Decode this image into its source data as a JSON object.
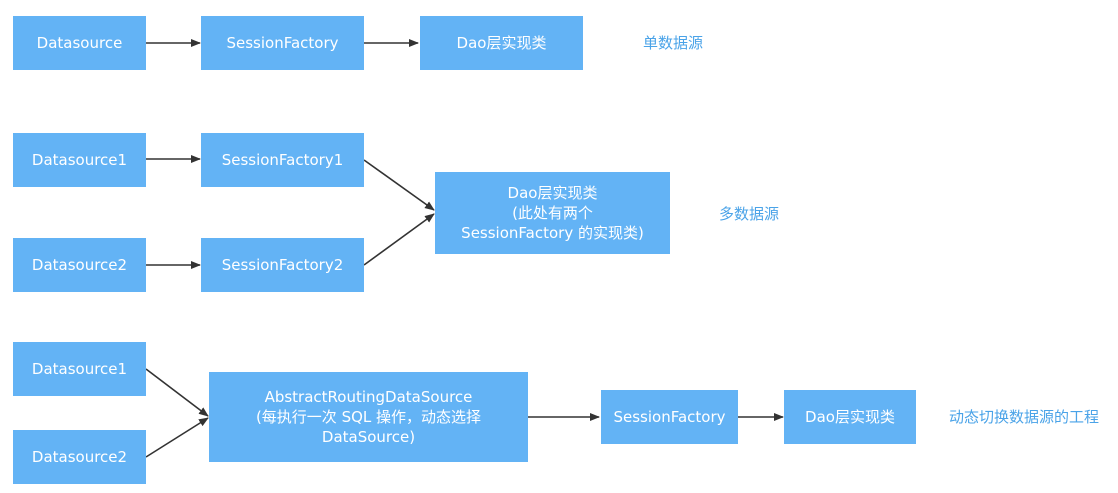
{
  "colors": {
    "node_fill": "#63b3f5",
    "node_text": "#ffffff",
    "caption": "#4aa3e8",
    "edge": "#333333"
  },
  "row1": {
    "datasource": "Datasource",
    "session_factory": "SessionFactory",
    "dao": "Dao层实现类",
    "caption": "单数据源"
  },
  "row2": {
    "datasource1": "Datasource1",
    "datasource2": "Datasource2",
    "session_factory1": "SessionFactory1",
    "session_factory2": "SessionFactory2",
    "dao": {
      "line1": "Dao层实现类",
      "line2": "(此处有两个",
      "line3": "SessionFactory 的实现类)"
    },
    "caption": "多数据源"
  },
  "row3": {
    "datasource1": "Datasource1",
    "datasource2": "Datasource2",
    "routing": {
      "line1": "AbstractRoutingDataSource",
      "line2": "(每执行一次 SQL 操作，动态选择",
      "line3": "DataSource)"
    },
    "session_factory": "SessionFactory",
    "dao": "Dao层实现类",
    "caption": "动态切换数据源的工程"
  }
}
